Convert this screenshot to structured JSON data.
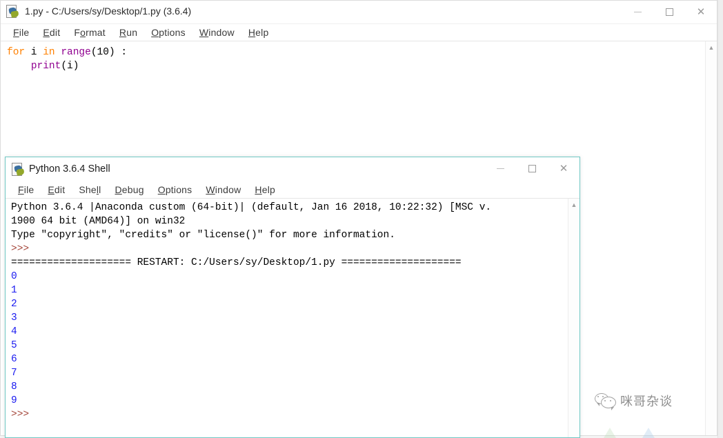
{
  "editor_window": {
    "title": "1.py - C:/Users/sy/Desktop/1.py (3.6.4)",
    "icon": "python-idle-icon",
    "menus": [
      {
        "label": "File",
        "accel": "F"
      },
      {
        "label": "Edit",
        "accel": "E"
      },
      {
        "label": "Format",
        "accel": "o"
      },
      {
        "label": "Run",
        "accel": "R"
      },
      {
        "label": "Options",
        "accel": "O"
      },
      {
        "label": "Window",
        "accel": "W"
      },
      {
        "label": "Help",
        "accel": "H"
      }
    ],
    "controls": {
      "minimize": "minimize-icon",
      "maximize": "maximize-icon",
      "close": "close-icon"
    },
    "code": {
      "line1": {
        "kw_for": "for",
        "var_i": " i ",
        "kw_in": "in",
        "fn_range": " range",
        "args": "(10) :"
      },
      "line2": {
        "indent": "    ",
        "fn_print": "print",
        "args": "(i)"
      }
    }
  },
  "shell_window": {
    "title": "Python 3.6.4 Shell",
    "icon": "python-idle-icon",
    "menus": [
      {
        "label": "File",
        "accel": "F"
      },
      {
        "label": "Edit",
        "accel": "E"
      },
      {
        "label": "Shell",
        "accel": "l"
      },
      {
        "label": "Debug",
        "accel": "D"
      },
      {
        "label": "Options",
        "accel": "O"
      },
      {
        "label": "Window",
        "accel": "W"
      },
      {
        "label": "Help",
        "accel": "H"
      }
    ],
    "controls": {
      "minimize": "minimize-icon",
      "maximize": "maximize-icon",
      "close": "close-icon"
    },
    "banner": {
      "line1": "Python 3.6.4 |Anaconda custom (64-bit)| (default, Jan 16 2018, 10:22:32) [MSC v.",
      "line2": "1900 64 bit (AMD64)] on win32",
      "line3": "Type \"copyright\", \"credits\" or \"license()\" for more information."
    },
    "prompt": ">>>",
    "restart_line": "==================== RESTART: C:/Users/sy/Desktop/1.py ====================",
    "output": [
      "0",
      "1",
      "2",
      "3",
      "4",
      "5",
      "6",
      "7",
      "8",
      "9"
    ],
    "final_prompt": ">>>"
  },
  "watermark": {
    "text": "咪哥杂谈",
    "icon": "wechat-icon"
  },
  "colors": {
    "keyword_orange": "#ff8000",
    "builtin_purple": "#900090",
    "prompt_red": "#a5483c",
    "output_blue": "#1a1af0",
    "active_window_border": "#6fc7c4"
  }
}
